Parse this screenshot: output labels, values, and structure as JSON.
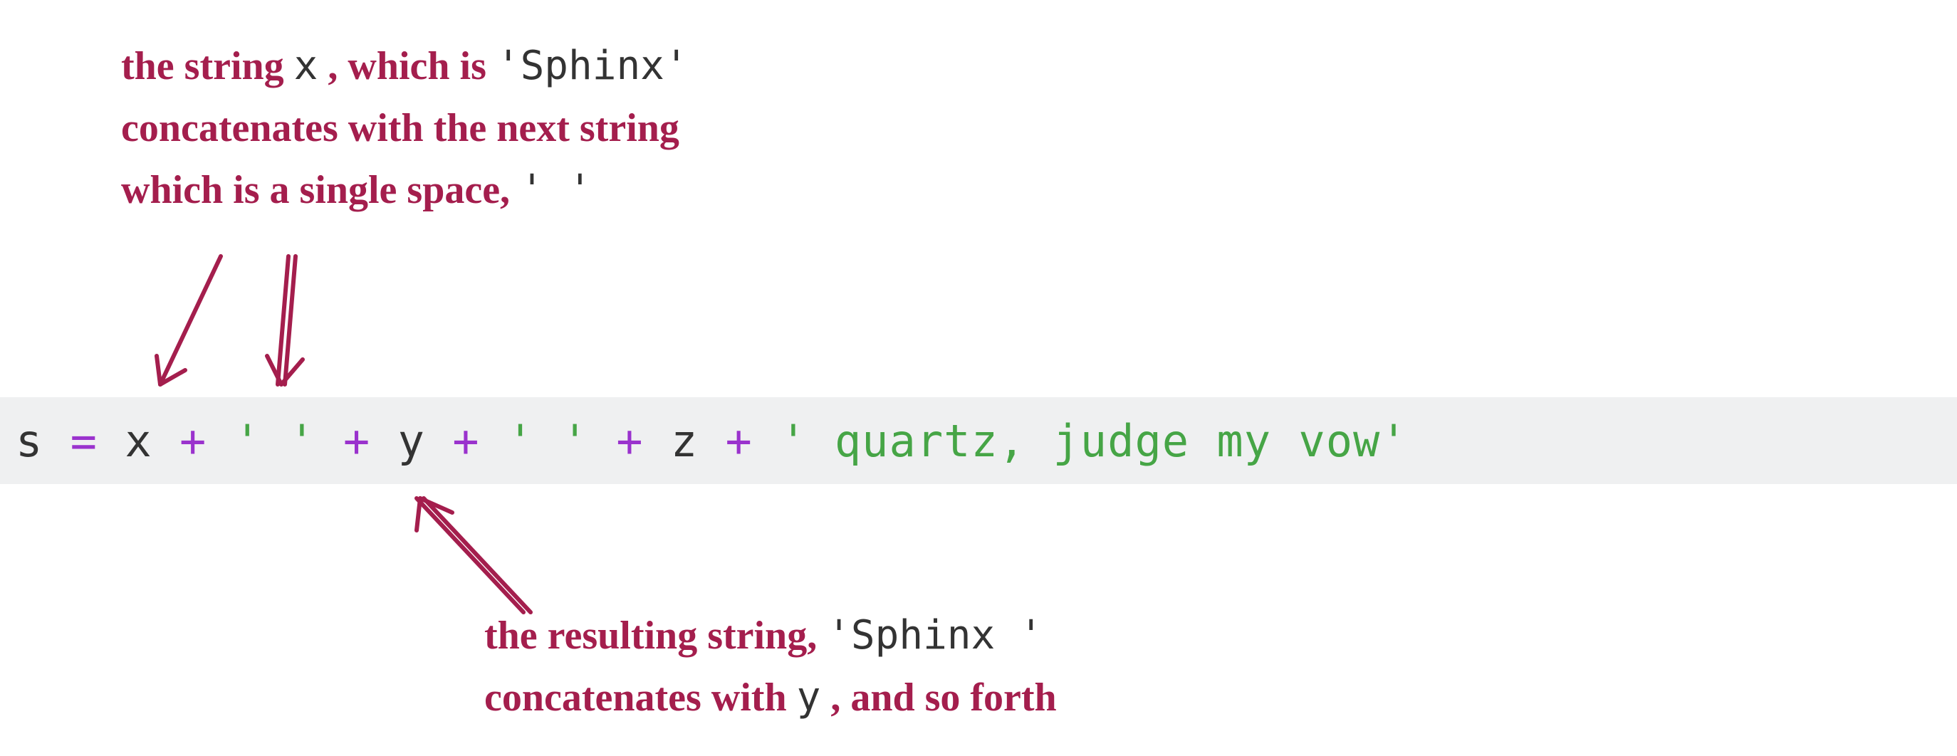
{
  "annotation_top": {
    "line1_pre": "the string",
    "line1_var": " x",
    "line1_mid": ", which is",
    "line1_val": " 'Sphinx'",
    "line2": "concatenates with the next string",
    "line3_pre": "which is a single space,",
    "line3_val": " ' '"
  },
  "annotation_bottom": {
    "line1_pre": "the resulting string,",
    "line1_val": " 'Sphinx '",
    "line2_pre": "concatenates with",
    "line2_var": " y",
    "line2_post": ", and so forth"
  },
  "code": {
    "t0": "s",
    "t1": " = ",
    "t2": "x",
    "t3": " + ",
    "t4": "' '",
    "t5": " + ",
    "t6": "y",
    "t7": " + ",
    "t8": "' '",
    "t9": " + ",
    "t10": "z",
    "t11": " + ",
    "t12": "' quartz, judge my vow'"
  }
}
